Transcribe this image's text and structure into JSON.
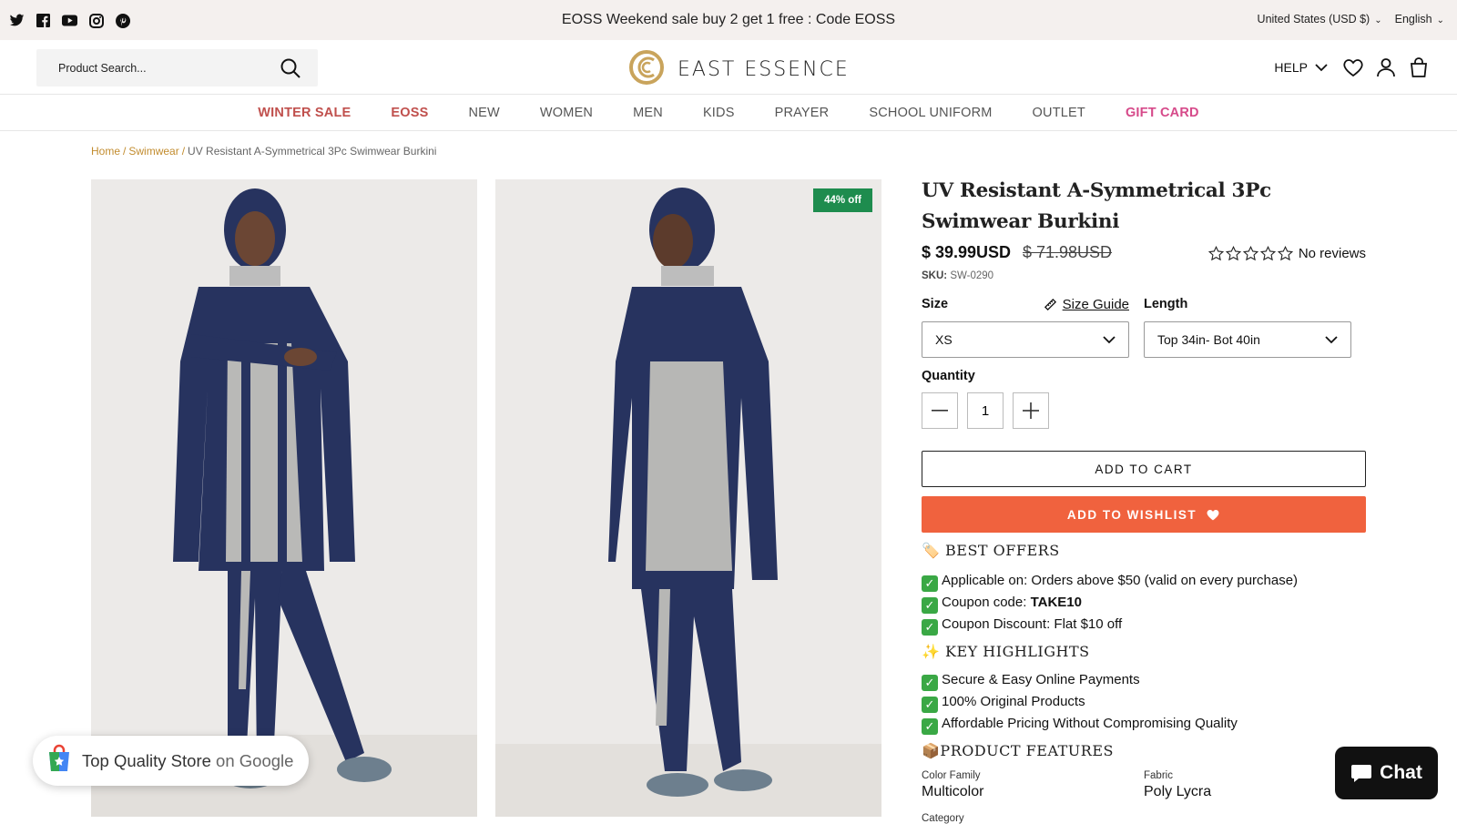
{
  "announcement": {
    "text": "EOSS Weekend sale buy 2 get 1 free : Code EOSS",
    "currency": "United States (USD $)",
    "language": "English",
    "social_icons": [
      "twitter-icon",
      "facebook-icon",
      "youtube-icon",
      "instagram-icon",
      "pinterest-icon"
    ]
  },
  "header": {
    "search_placeholder": "Product Search...",
    "logo_text": "EAST ESSENCE",
    "help_label": "HELP"
  },
  "nav": {
    "items": [
      "WINTER SALE",
      "EOSS",
      "NEW",
      "WOMEN",
      "MEN",
      "KIDS",
      "PRAYER",
      "SCHOOL UNIFORM",
      "OUTLET",
      "GIFT CARD"
    ]
  },
  "breadcrumb": {
    "home": "Home",
    "sep": "/",
    "category": "Swimwear",
    "current": "UV Resistant A-Symmetrical 3Pc Swimwear Burkini"
  },
  "gallery": {
    "badge": "44% off"
  },
  "product": {
    "title": "UV Resistant A-Symmetrical 3Pc Swimwear Burkini",
    "price": "$ 39.99USD",
    "compare_price": "$ 71.98USD",
    "reviews_label": "No reviews",
    "rating": 0,
    "sku_label": "SKU:",
    "sku_value": "SW-0290",
    "size_label": "Size",
    "size_guide": "Size Guide",
    "size_value": "XS",
    "length_label": "Length",
    "length_value": "Top 34in- Bot 40in",
    "quantity_label": "Quantity",
    "quantity_value": "1",
    "add_to_cart": "ADD TO CART",
    "add_to_wishlist": "ADD TO WISHLIST"
  },
  "offers": {
    "title": "BEST OFFERS",
    "items": [
      {
        "text": "Applicable on: Orders above $50 (valid on every purchase)",
        "bold": ""
      },
      {
        "text": "Coupon code: ",
        "bold": "TAKE10"
      },
      {
        "text": "Coupon Discount: Flat $10 off",
        "bold": ""
      }
    ]
  },
  "highlights": {
    "title": "KEY HIGHLIGHTS",
    "items": [
      "Secure & Easy Online Payments",
      "100% Original Products",
      "Affordable Pricing Without Compromising Quality"
    ]
  },
  "features": {
    "title": "PRODUCT FEATURES",
    "color_family_label": "Color Family",
    "color_family_value": "Multicolor",
    "fabric_label": "Fabric",
    "fabric_value": "Poly Lycra",
    "category_label": "Category"
  },
  "google_badge": {
    "text": "Top Quality Store",
    "suffix": " on Google"
  },
  "chat": {
    "label": "Chat"
  },
  "colors": {
    "accent_sale": "#c0504d",
    "gift": "#d64a8a",
    "wishlist_btn": "#f0623e",
    "badge": "#1e8c4e",
    "breadcrumb_link": "#c28c2e"
  }
}
